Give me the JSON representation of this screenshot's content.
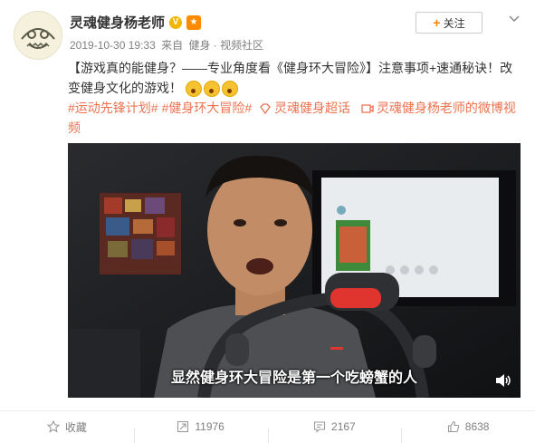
{
  "author": {
    "name": "灵魂健身杨老师",
    "verified_badge": "V",
    "medal_icon": "medal-icon"
  },
  "meta": {
    "time": "2019-10-30 19:33",
    "source_prefix": "来自",
    "source": "健身 · 视频社区"
  },
  "follow": {
    "plus": "+",
    "label": "关注"
  },
  "post": {
    "text": "【游戏真的能健身？——专业角度看《健身环大冒险》】注意事项+速通秘诀！改变健身文化的游戏！",
    "emojis": [
      "surprised-face-icon",
      "surprised-face-icon",
      "surprised-face-icon"
    ],
    "topics": [
      "#运动先锋计划#",
      "#健身环大冒险#"
    ],
    "super_topic": "灵魂健身超话",
    "video_link": "灵魂健身杨老师的微博视频"
  },
  "video": {
    "subtitle": "显然健身环大冒险是第一个吃螃蟹的人"
  },
  "actions": {
    "favorite": "收藏",
    "repost": "11976",
    "comment": "2167",
    "like": "8638"
  },
  "colors": {
    "link": "#eb7350",
    "accent": "#ff8200"
  }
}
